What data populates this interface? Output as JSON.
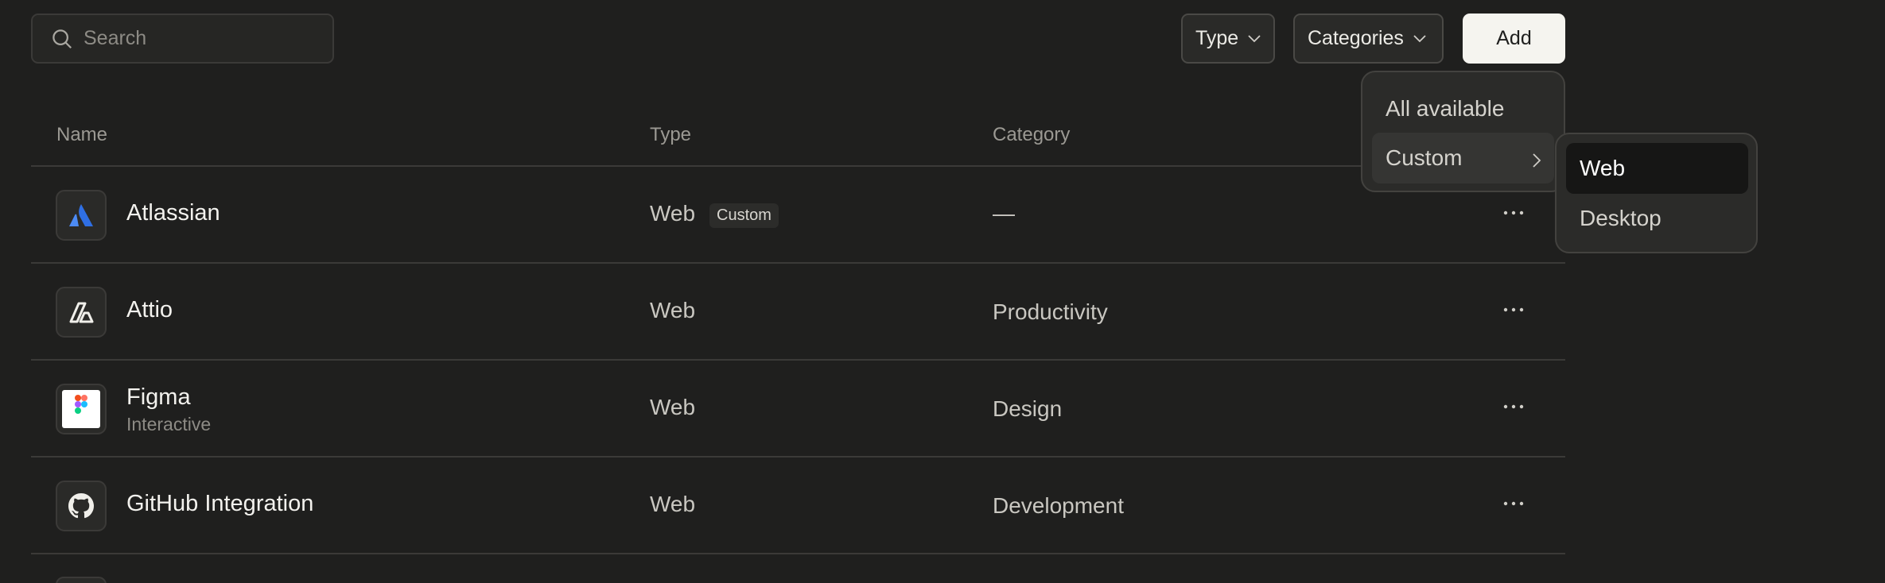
{
  "search": {
    "placeholder": "Search",
    "icon": "search-icon"
  },
  "toolbar": {
    "type_label": "Type",
    "categories_label": "Categories",
    "add_label": "Add"
  },
  "table": {
    "headers": {
      "name": "Name",
      "type": "Type",
      "category": "Category"
    },
    "rows": [
      {
        "name": "Atlassian",
        "subtitle": "",
        "type": "Web",
        "badge": "Custom",
        "category": "—",
        "icon": "atlassian-logo-icon"
      },
      {
        "name": "Attio",
        "subtitle": "",
        "type": "Web",
        "badge": "",
        "category": "Productivity",
        "icon": "attio-logo-icon"
      },
      {
        "name": "Figma",
        "subtitle": "Interactive",
        "type": "Web",
        "badge": "",
        "category": "Design",
        "icon": "figma-logo-icon"
      },
      {
        "name": "GitHub Integration",
        "subtitle": "",
        "type": "Web",
        "badge": "",
        "category": "Development",
        "icon": "github-logo-icon"
      }
    ]
  },
  "type_menu": {
    "items": [
      "All available",
      "Custom"
    ],
    "active": "Custom"
  },
  "custom_submenu": {
    "items": [
      "Web",
      "Desktop"
    ],
    "selected": "Web"
  },
  "colors": {
    "background": "#1f1f1e",
    "border": "#3b3a38",
    "add_button_bg": "#f5f4ef",
    "atlassian_blue": "#2f6fe4"
  }
}
